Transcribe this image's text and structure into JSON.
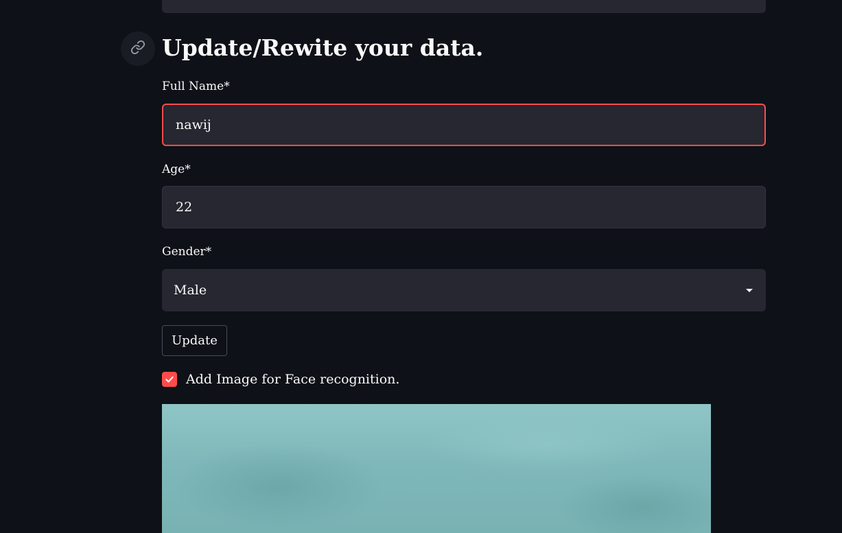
{
  "form": {
    "heading": "Update/Rewite your data.",
    "full_name": {
      "label": "Full Name*",
      "value": "nawij"
    },
    "age": {
      "label": "Age*",
      "value": "22"
    },
    "gender": {
      "label": "Gender*",
      "selected": "Male"
    },
    "update_button": "Update",
    "face_checkbox": {
      "label": "Add Image for Face recognition.",
      "checked": true
    }
  },
  "colors": {
    "background": "#0e1117",
    "input_background": "#262730",
    "accent": "#ff4b4b",
    "text": "#fafafa"
  },
  "icons": {
    "anchor": "link-icon",
    "select_caret": "caret-down-icon",
    "checkbox_mark": "check-icon"
  }
}
